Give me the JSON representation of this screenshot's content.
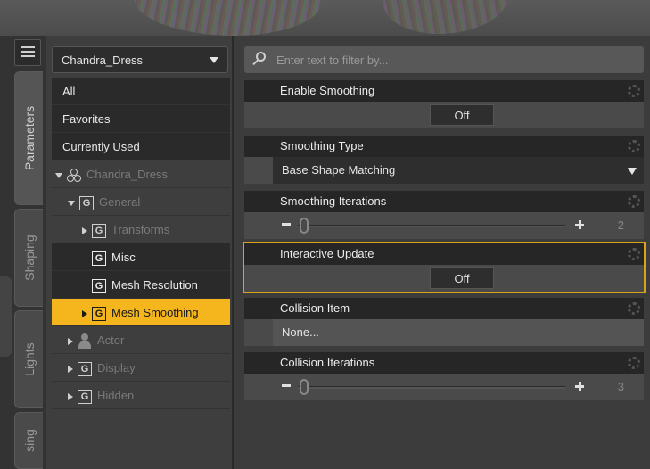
{
  "tabs": {
    "parameters": "Parameters",
    "shaping": "Shaping",
    "lights": "Lights",
    "posing": "sing"
  },
  "node_selector": {
    "value": "Chandra_Dress"
  },
  "tree": {
    "all": "All",
    "favorites": "Favorites",
    "currently_used": "Currently Used",
    "node": "Chandra_Dress",
    "general": "General",
    "transforms": "Transforms",
    "misc": "Misc",
    "mesh_resolution": "Mesh Resolution",
    "mesh_smoothing": "Mesh Smoothing",
    "actor": "Actor",
    "display": "Display",
    "hidden": "Hidden",
    "group_glyph": "G"
  },
  "filter": {
    "placeholder": "Enter text to filter by..."
  },
  "params": {
    "enable_smoothing": {
      "label": "Enable Smoothing",
      "value": "Off"
    },
    "smoothing_type": {
      "label": "Smoothing Type",
      "value": "Base Shape Matching"
    },
    "smoothing_iterations": {
      "label": "Smoothing Iterations",
      "value": "2"
    },
    "interactive_update": {
      "label": "Interactive Update",
      "value": "Off"
    },
    "collision_item": {
      "label": "Collision Item",
      "value": "None..."
    },
    "collision_iterations": {
      "label": "Collision Iterations",
      "value": "3"
    }
  },
  "colors": {
    "selected_accent": "#f4b61c",
    "highlight_outline": "#d9a41c"
  }
}
